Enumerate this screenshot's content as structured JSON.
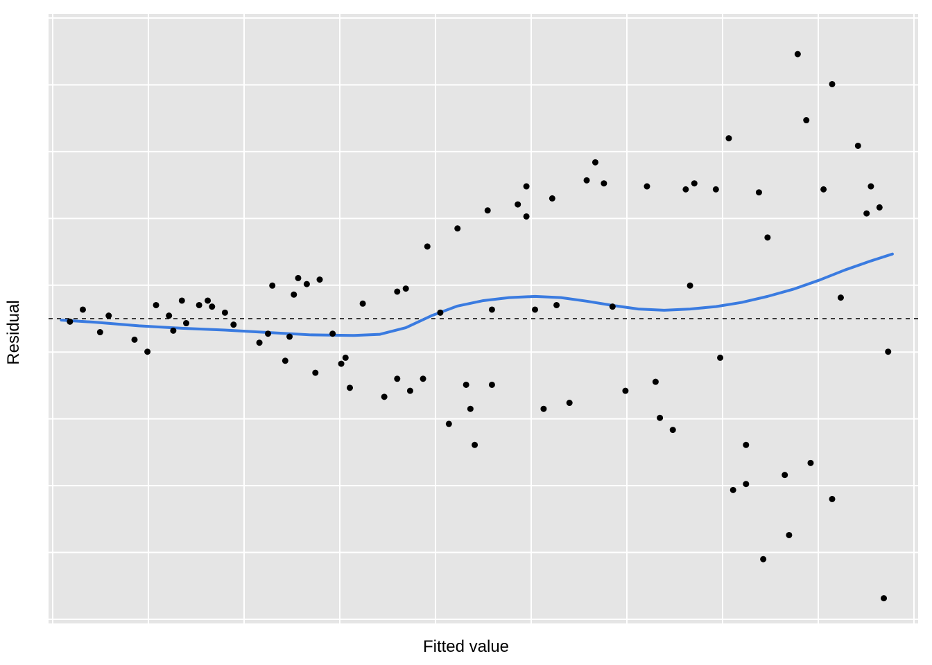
{
  "chart_data": {
    "type": "scatter",
    "title": "",
    "xlabel": "Fitted value",
    "ylabel": "Residual",
    "xlim": [
      0,
      100
    ],
    "ylim": [
      -100,
      100
    ],
    "hline": 0,
    "smooth_color": "#3a7be0",
    "points": [
      [
        2.0,
        -1.0
      ],
      [
        3.5,
        3.0
      ],
      [
        5.5,
        -4.5
      ],
      [
        6.5,
        1.0
      ],
      [
        9.5,
        -7.0
      ],
      [
        11.0,
        -11.0
      ],
      [
        12.0,
        4.5
      ],
      [
        13.5,
        1.0
      ],
      [
        14.0,
        -4.0
      ],
      [
        15.0,
        6.0
      ],
      [
        15.5,
        -1.5
      ],
      [
        17.0,
        4.5
      ],
      [
        18.0,
        6.0
      ],
      [
        18.5,
        4.0
      ],
      [
        20.0,
        2.0
      ],
      [
        21.0,
        -2.0
      ],
      [
        24.0,
        -8.0
      ],
      [
        25.0,
        -5.0
      ],
      [
        25.5,
        11.0
      ],
      [
        27.0,
        -14.0
      ],
      [
        27.5,
        -6.0
      ],
      [
        28.0,
        8.0
      ],
      [
        28.5,
        13.5
      ],
      [
        29.5,
        11.5
      ],
      [
        30.5,
        -18.0
      ],
      [
        31.0,
        13.0
      ],
      [
        32.5,
        -5.0
      ],
      [
        33.5,
        -15.0
      ],
      [
        34.0,
        -13.0
      ],
      [
        34.5,
        -23.0
      ],
      [
        36.0,
        5.0
      ],
      [
        38.5,
        -26.0
      ],
      [
        40.0,
        -20.0
      ],
      [
        40.0,
        9.0
      ],
      [
        41.0,
        10.0
      ],
      [
        41.5,
        -24.0
      ],
      [
        43.0,
        -20.0
      ],
      [
        43.5,
        24.0
      ],
      [
        45.0,
        2.0
      ],
      [
        46.0,
        -35.0
      ],
      [
        47.0,
        30.0
      ],
      [
        48.0,
        -22.0
      ],
      [
        48.5,
        -30.0
      ],
      [
        49.0,
        -42.0
      ],
      [
        50.5,
        36.0
      ],
      [
        51.0,
        -22.0
      ],
      [
        51.0,
        3.0
      ],
      [
        54.0,
        38.0
      ],
      [
        55.0,
        44.0
      ],
      [
        55.0,
        34.0
      ],
      [
        56.0,
        3.0
      ],
      [
        57.0,
        -30.0
      ],
      [
        58.0,
        40.0
      ],
      [
        58.5,
        4.5
      ],
      [
        60.0,
        -28.0
      ],
      [
        62.0,
        46.0
      ],
      [
        63.0,
        52.0
      ],
      [
        64.0,
        45.0
      ],
      [
        65.0,
        4.0
      ],
      [
        66.5,
        -24.0
      ],
      [
        69.0,
        44.0
      ],
      [
        70.0,
        -21.0
      ],
      [
        70.5,
        -33.0
      ],
      [
        72.0,
        -37.0
      ],
      [
        73.5,
        43.0
      ],
      [
        74.0,
        11.0
      ],
      [
        74.5,
        45.0
      ],
      [
        77.0,
        43.0
      ],
      [
        77.5,
        -13.0
      ],
      [
        78.5,
        60.0
      ],
      [
        79.0,
        -57.0
      ],
      [
        80.5,
        -55.0
      ],
      [
        80.5,
        -42.0
      ],
      [
        82.0,
        42.0
      ],
      [
        82.5,
        -80.0
      ],
      [
        83.0,
        27.0
      ],
      [
        85.0,
        -52.0
      ],
      [
        85.5,
        -72.0
      ],
      [
        86.5,
        88.0
      ],
      [
        87.5,
        66.0
      ],
      [
        88.0,
        -48.0
      ],
      [
        89.5,
        43.0
      ],
      [
        90.5,
        78.0
      ],
      [
        90.5,
        -60.0
      ],
      [
        91.5,
        7.0
      ],
      [
        93.5,
        57.5
      ],
      [
        94.5,
        35.0
      ],
      [
        95.0,
        44.0
      ],
      [
        96.0,
        37.0
      ],
      [
        96.5,
        -93.0
      ],
      [
        97.0,
        -11.0
      ]
    ],
    "smooth": [
      [
        1.0,
        -0.5
      ],
      [
        5.0,
        -1.2
      ],
      [
        10.0,
        -2.4
      ],
      [
        15.0,
        -3.2
      ],
      [
        20.0,
        -3.8
      ],
      [
        25.0,
        -4.6
      ],
      [
        30.0,
        -5.4
      ],
      [
        35.0,
        -5.6
      ],
      [
        38.0,
        -5.2
      ],
      [
        41.0,
        -3.0
      ],
      [
        44.0,
        1.0
      ],
      [
        47.0,
        4.2
      ],
      [
        50.0,
        6.0
      ],
      [
        53.0,
        7.0
      ],
      [
        56.0,
        7.4
      ],
      [
        59.0,
        7.0
      ],
      [
        62.0,
        5.8
      ],
      [
        65.0,
        4.4
      ],
      [
        68.0,
        3.2
      ],
      [
        71.0,
        2.8
      ],
      [
        74.0,
        3.2
      ],
      [
        77.0,
        4.0
      ],
      [
        80.0,
        5.4
      ],
      [
        83.0,
        7.4
      ],
      [
        86.0,
        9.8
      ],
      [
        89.0,
        12.8
      ],
      [
        92.0,
        16.2
      ],
      [
        95.0,
        19.2
      ],
      [
        97.5,
        21.5
      ]
    ]
  },
  "grid": {
    "x_count": 9,
    "y_count": 9
  }
}
